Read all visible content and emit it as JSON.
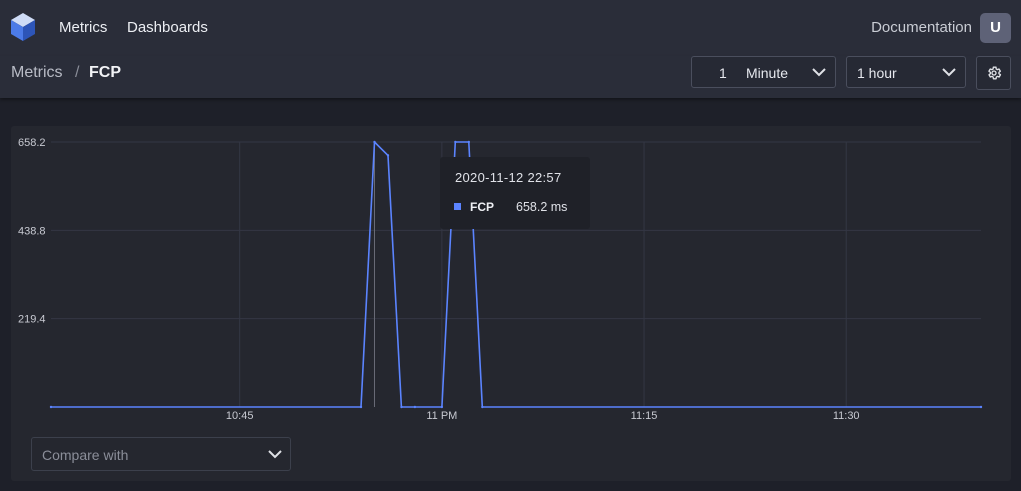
{
  "app": {
    "nav": [
      "Metrics",
      "Dashboards"
    ],
    "documentation_label": "Documentation",
    "avatar_initial": "U"
  },
  "breadcrumb": {
    "parent": "Metrics",
    "separator": "/",
    "current": "FCP"
  },
  "controls": {
    "interval_count": "1",
    "interval_unit": "Minute",
    "range": "1 hour",
    "settings_icon": "gear-icon"
  },
  "tooltip": {
    "time": "2020-11-12 22:57",
    "series_name": "FCP",
    "value": "658.2 ms"
  },
  "compare": {
    "placeholder": "Compare with"
  },
  "colors": {
    "series": "#5b84ff",
    "background": "#1e2029",
    "panel": "#25272f"
  },
  "chart_data": {
    "type": "line",
    "title": "",
    "xlabel": "",
    "ylabel": "",
    "ylim": [
      0,
      658.2
    ],
    "y_ticks": [
      "219.4",
      "438.8",
      "658.2"
    ],
    "x_tick_labels": [
      "10:45",
      "11 PM",
      "11:15",
      "11:30"
    ],
    "x_tick_minutes": [
      45,
      60,
      75,
      90
    ],
    "x_range_minutes": [
      31,
      100
    ],
    "grid": true,
    "series": [
      {
        "name": "FCP",
        "x": [
          31,
          54,
          55,
          56,
          57,
          58,
          60,
          61,
          62,
          63,
          100
        ],
        "values": [
          0,
          0,
          658.2,
          625,
          0,
          0,
          0,
          658.2,
          658.2,
          0,
          0
        ]
      }
    ],
    "hover_x": 55
  }
}
